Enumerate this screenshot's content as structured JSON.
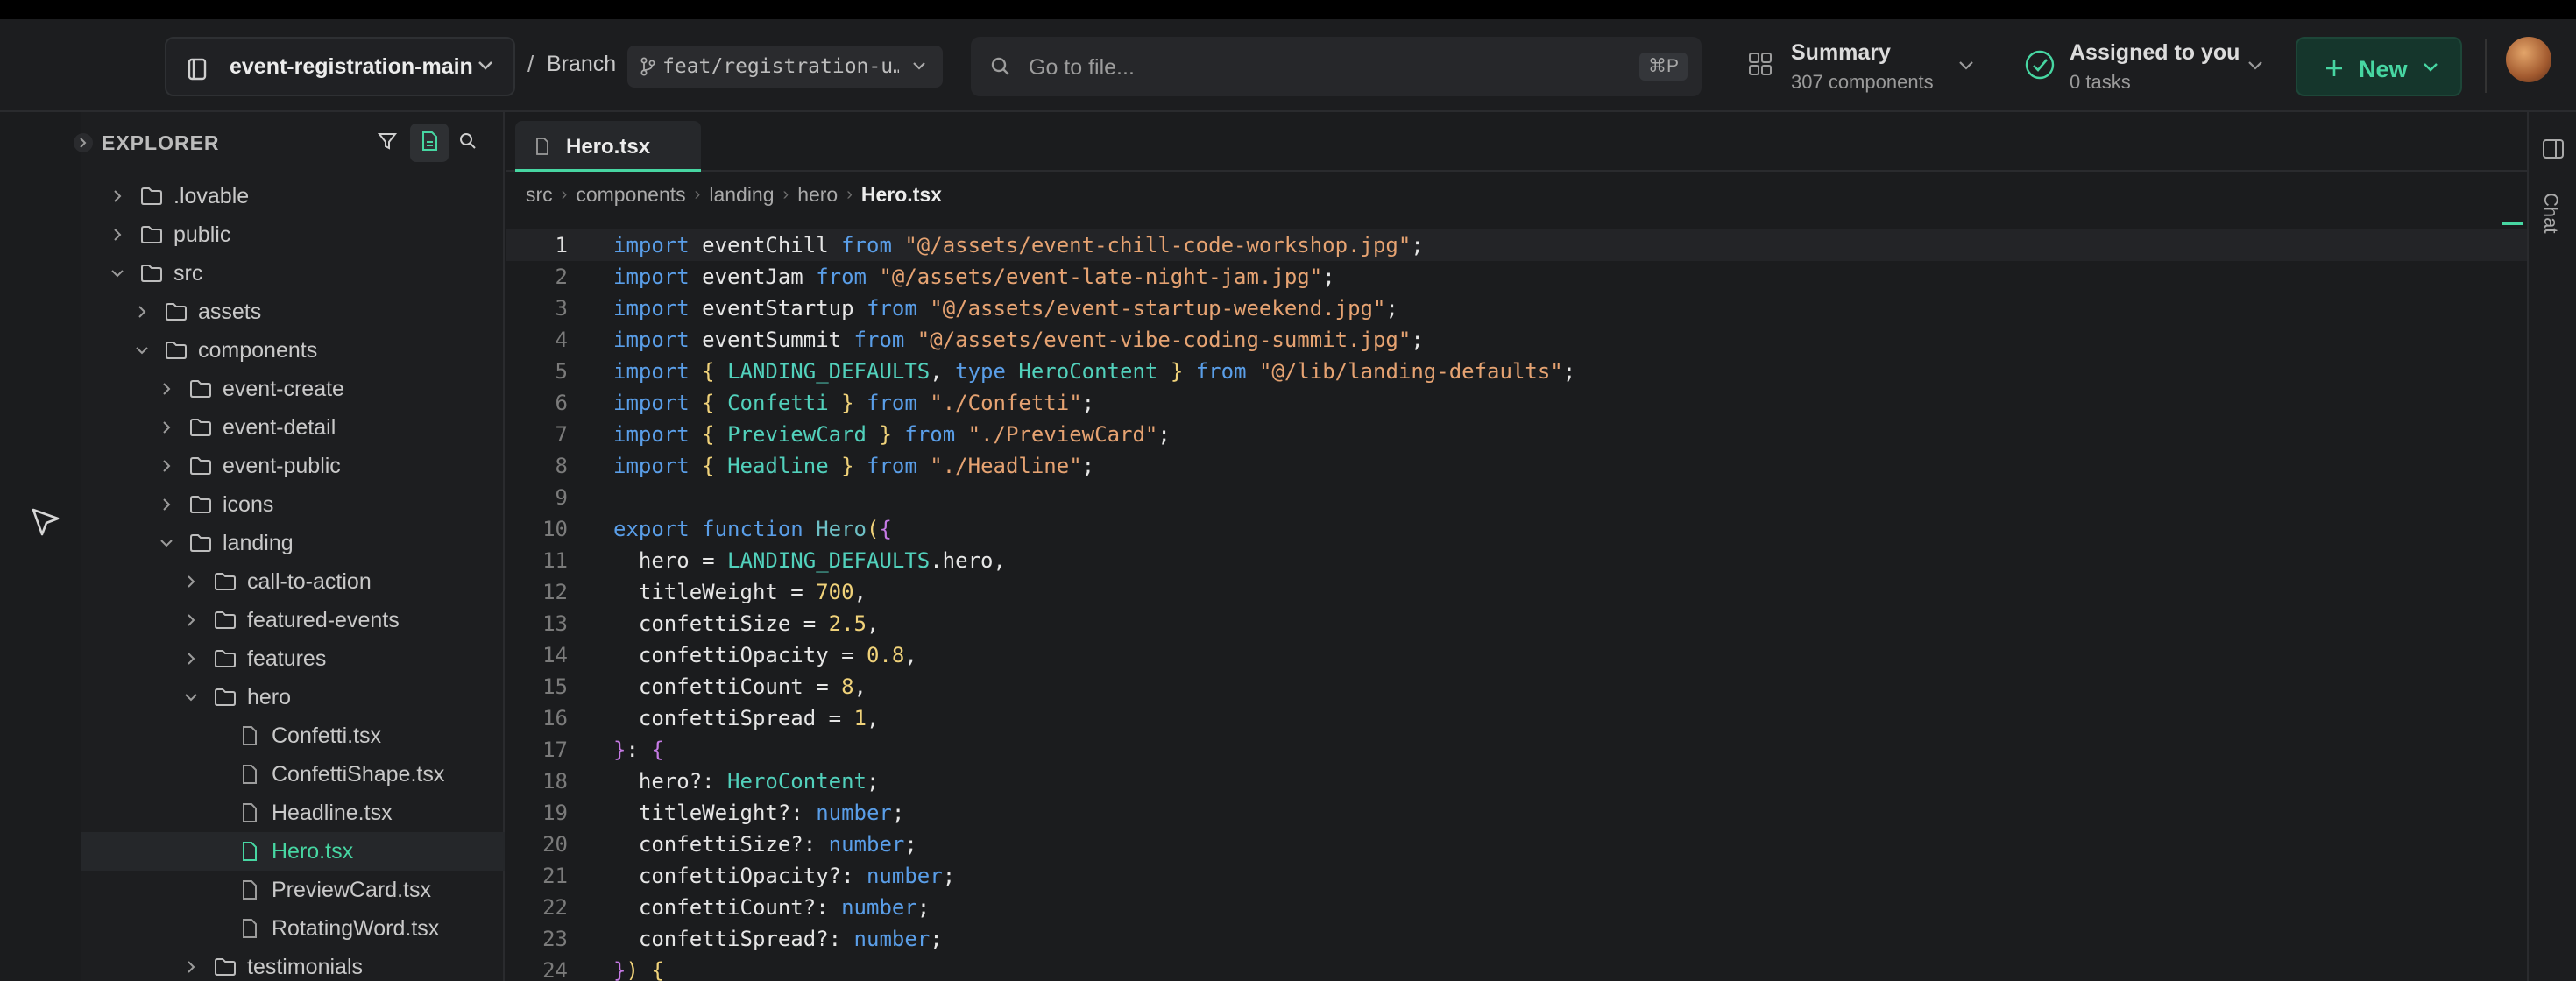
{
  "header": {
    "repo_name": "event-registration-main",
    "separator": "/",
    "branch_label": "Branch",
    "branch_name": "feat/registration-u…",
    "search_placeholder": "Go to file...",
    "search_shortcut": "⌘P",
    "summary_title": "Summary",
    "summary_sub": "307 components",
    "assigned_title": "Assigned to you",
    "assigned_sub": "0 tasks",
    "new_label": "New"
  },
  "sidebar": {
    "title": "EXPLORER",
    "tree": [
      {
        "label": ".lovable",
        "type": "folder",
        "depth": 0,
        "expanded": false
      },
      {
        "label": "public",
        "type": "folder",
        "depth": 0,
        "expanded": false
      },
      {
        "label": "src",
        "type": "folder",
        "depth": 0,
        "expanded": true
      },
      {
        "label": "assets",
        "type": "folder",
        "depth": 1,
        "expanded": false
      },
      {
        "label": "components",
        "type": "folder",
        "depth": 1,
        "expanded": true
      },
      {
        "label": "event-create",
        "type": "folder",
        "depth": 2,
        "expanded": false
      },
      {
        "label": "event-detail",
        "type": "folder",
        "depth": 2,
        "expanded": false
      },
      {
        "label": "event-public",
        "type": "folder",
        "depth": 2,
        "expanded": false
      },
      {
        "label": "icons",
        "type": "folder",
        "depth": 2,
        "expanded": false
      },
      {
        "label": "landing",
        "type": "folder",
        "depth": 2,
        "expanded": true
      },
      {
        "label": "call-to-action",
        "type": "folder",
        "depth": 3,
        "expanded": false
      },
      {
        "label": "featured-events",
        "type": "folder",
        "depth": 3,
        "expanded": false
      },
      {
        "label": "features",
        "type": "folder",
        "depth": 3,
        "expanded": false
      },
      {
        "label": "hero",
        "type": "folder",
        "depth": 3,
        "expanded": true
      },
      {
        "label": "Confetti.tsx",
        "type": "file",
        "depth": 4
      },
      {
        "label": "ConfettiShape.tsx",
        "type": "file",
        "depth": 4
      },
      {
        "label": "Headline.tsx",
        "type": "file",
        "depth": 4
      },
      {
        "label": "Hero.tsx",
        "type": "file",
        "depth": 4,
        "active": true
      },
      {
        "label": "PreviewCard.tsx",
        "type": "file",
        "depth": 4
      },
      {
        "label": "RotatingWord.tsx",
        "type": "file",
        "depth": 4
      },
      {
        "label": "testimonials",
        "type": "folder",
        "depth": 3,
        "expanded": false
      }
    ]
  },
  "editor": {
    "tab_label": "Hero.tsx",
    "breadcrumbs": [
      "src",
      "components",
      "landing",
      "hero",
      "Hero.tsx"
    ],
    "current_line": 1,
    "lines": [
      [
        [
          "k",
          "import"
        ],
        [
          "v",
          " eventChill "
        ],
        [
          "k",
          "from"
        ],
        [
          "v",
          " "
        ],
        [
          "s",
          "\"@/assets/event-chill-code-workshop.jpg\""
        ],
        [
          "v",
          ";"
        ]
      ],
      [
        [
          "k",
          "import"
        ],
        [
          "v",
          " eventJam "
        ],
        [
          "k",
          "from"
        ],
        [
          "v",
          " "
        ],
        [
          "s",
          "\"@/assets/event-late-night-jam.jpg\""
        ],
        [
          "v",
          ";"
        ]
      ],
      [
        [
          "k",
          "import"
        ],
        [
          "v",
          " eventStartup "
        ],
        [
          "k",
          "from"
        ],
        [
          "v",
          " "
        ],
        [
          "s",
          "\"@/assets/event-startup-weekend.jpg\""
        ],
        [
          "v",
          ";"
        ]
      ],
      [
        [
          "k",
          "import"
        ],
        [
          "v",
          " eventSummit "
        ],
        [
          "k",
          "from"
        ],
        [
          "v",
          " "
        ],
        [
          "s",
          "\"@/assets/event-vibe-coding-summit.jpg\""
        ],
        [
          "v",
          ";"
        ]
      ],
      [
        [
          "k",
          "import"
        ],
        [
          "v",
          " "
        ],
        [
          "b",
          "{"
        ],
        [
          "v",
          " "
        ],
        [
          "c",
          "LANDING_DEFAULTS"
        ],
        [
          "v",
          ", "
        ],
        [
          "k",
          "type"
        ],
        [
          "v",
          " "
        ],
        [
          "c",
          "HeroContent"
        ],
        [
          "v",
          " "
        ],
        [
          "b",
          "}"
        ],
        [
          "v",
          " "
        ],
        [
          "k",
          "from"
        ],
        [
          "v",
          " "
        ],
        [
          "s",
          "\"@/lib/landing-defaults\""
        ],
        [
          "v",
          ";"
        ]
      ],
      [
        [
          "k",
          "import"
        ],
        [
          "v",
          " "
        ],
        [
          "b",
          "{"
        ],
        [
          "v",
          " "
        ],
        [
          "c",
          "Confetti"
        ],
        [
          "v",
          " "
        ],
        [
          "b",
          "}"
        ],
        [
          "v",
          " "
        ],
        [
          "k",
          "from"
        ],
        [
          "v",
          " "
        ],
        [
          "s",
          "\"./Confetti\""
        ],
        [
          "v",
          ";"
        ]
      ],
      [
        [
          "k",
          "import"
        ],
        [
          "v",
          " "
        ],
        [
          "b",
          "{"
        ],
        [
          "v",
          " "
        ],
        [
          "c",
          "PreviewCard"
        ],
        [
          "v",
          " "
        ],
        [
          "b",
          "}"
        ],
        [
          "v",
          " "
        ],
        [
          "k",
          "from"
        ],
        [
          "v",
          " "
        ],
        [
          "s",
          "\"./PreviewCard\""
        ],
        [
          "v",
          ";"
        ]
      ],
      [
        [
          "k",
          "import"
        ],
        [
          "v",
          " "
        ],
        [
          "b",
          "{"
        ],
        [
          "v",
          " "
        ],
        [
          "c",
          "Headline"
        ],
        [
          "v",
          " "
        ],
        [
          "b",
          "}"
        ],
        [
          "v",
          " "
        ],
        [
          "k",
          "from"
        ],
        [
          "v",
          " "
        ],
        [
          "s",
          "\"./Headline\""
        ],
        [
          "v",
          ";"
        ]
      ],
      [],
      [
        [
          "k",
          "export"
        ],
        [
          "v",
          " "
        ],
        [
          "k",
          "function"
        ],
        [
          "v",
          " "
        ],
        [
          "f",
          "Hero"
        ],
        [
          "b",
          "("
        ],
        [
          "p",
          "{"
        ]
      ],
      [
        [
          "v",
          "  hero = "
        ],
        [
          "c",
          "LANDING_DEFAULTS"
        ],
        [
          "v",
          ".hero,"
        ]
      ],
      [
        [
          "v",
          "  titleWeight = "
        ],
        [
          "n",
          "700"
        ],
        [
          "v",
          ","
        ]
      ],
      [
        [
          "v",
          "  confettiSize = "
        ],
        [
          "n",
          "2.5"
        ],
        [
          "v",
          ","
        ]
      ],
      [
        [
          "v",
          "  confettiOpacity = "
        ],
        [
          "n",
          "0.8"
        ],
        [
          "v",
          ","
        ]
      ],
      [
        [
          "v",
          "  confettiCount = "
        ],
        [
          "n",
          "8"
        ],
        [
          "v",
          ","
        ]
      ],
      [
        [
          "v",
          "  confettiSpread = "
        ],
        [
          "n",
          "1"
        ],
        [
          "v",
          ","
        ]
      ],
      [
        [
          "p",
          "}"
        ],
        [
          "v",
          ": "
        ],
        [
          "p",
          "{"
        ]
      ],
      [
        [
          "v",
          "  hero?: "
        ],
        [
          "c",
          "HeroContent"
        ],
        [
          "v",
          ";"
        ]
      ],
      [
        [
          "v",
          "  titleWeight?: "
        ],
        [
          "k",
          "number"
        ],
        [
          "v",
          ";"
        ]
      ],
      [
        [
          "v",
          "  confettiSize?: "
        ],
        [
          "k",
          "number"
        ],
        [
          "v",
          ";"
        ]
      ],
      [
        [
          "v",
          "  confettiOpacity?: "
        ],
        [
          "k",
          "number"
        ],
        [
          "v",
          ";"
        ]
      ],
      [
        [
          "v",
          "  confettiCount?: "
        ],
        [
          "k",
          "number"
        ],
        [
          "v",
          ";"
        ]
      ],
      [
        [
          "v",
          "  confettiSpread?: "
        ],
        [
          "k",
          "number"
        ],
        [
          "v",
          ";"
        ]
      ],
      [
        [
          "p",
          "}"
        ],
        [
          "b",
          ")"
        ],
        [
          "v",
          " "
        ],
        [
          "b",
          "{"
        ]
      ]
    ]
  },
  "rightrail": {
    "chat_label": "Chat"
  },
  "colors": {
    "accent": "#47d6a2",
    "keyword": "#5a9ee8",
    "string": "#e6a372",
    "type": "#52d1bc",
    "number": "#f0d27a"
  }
}
